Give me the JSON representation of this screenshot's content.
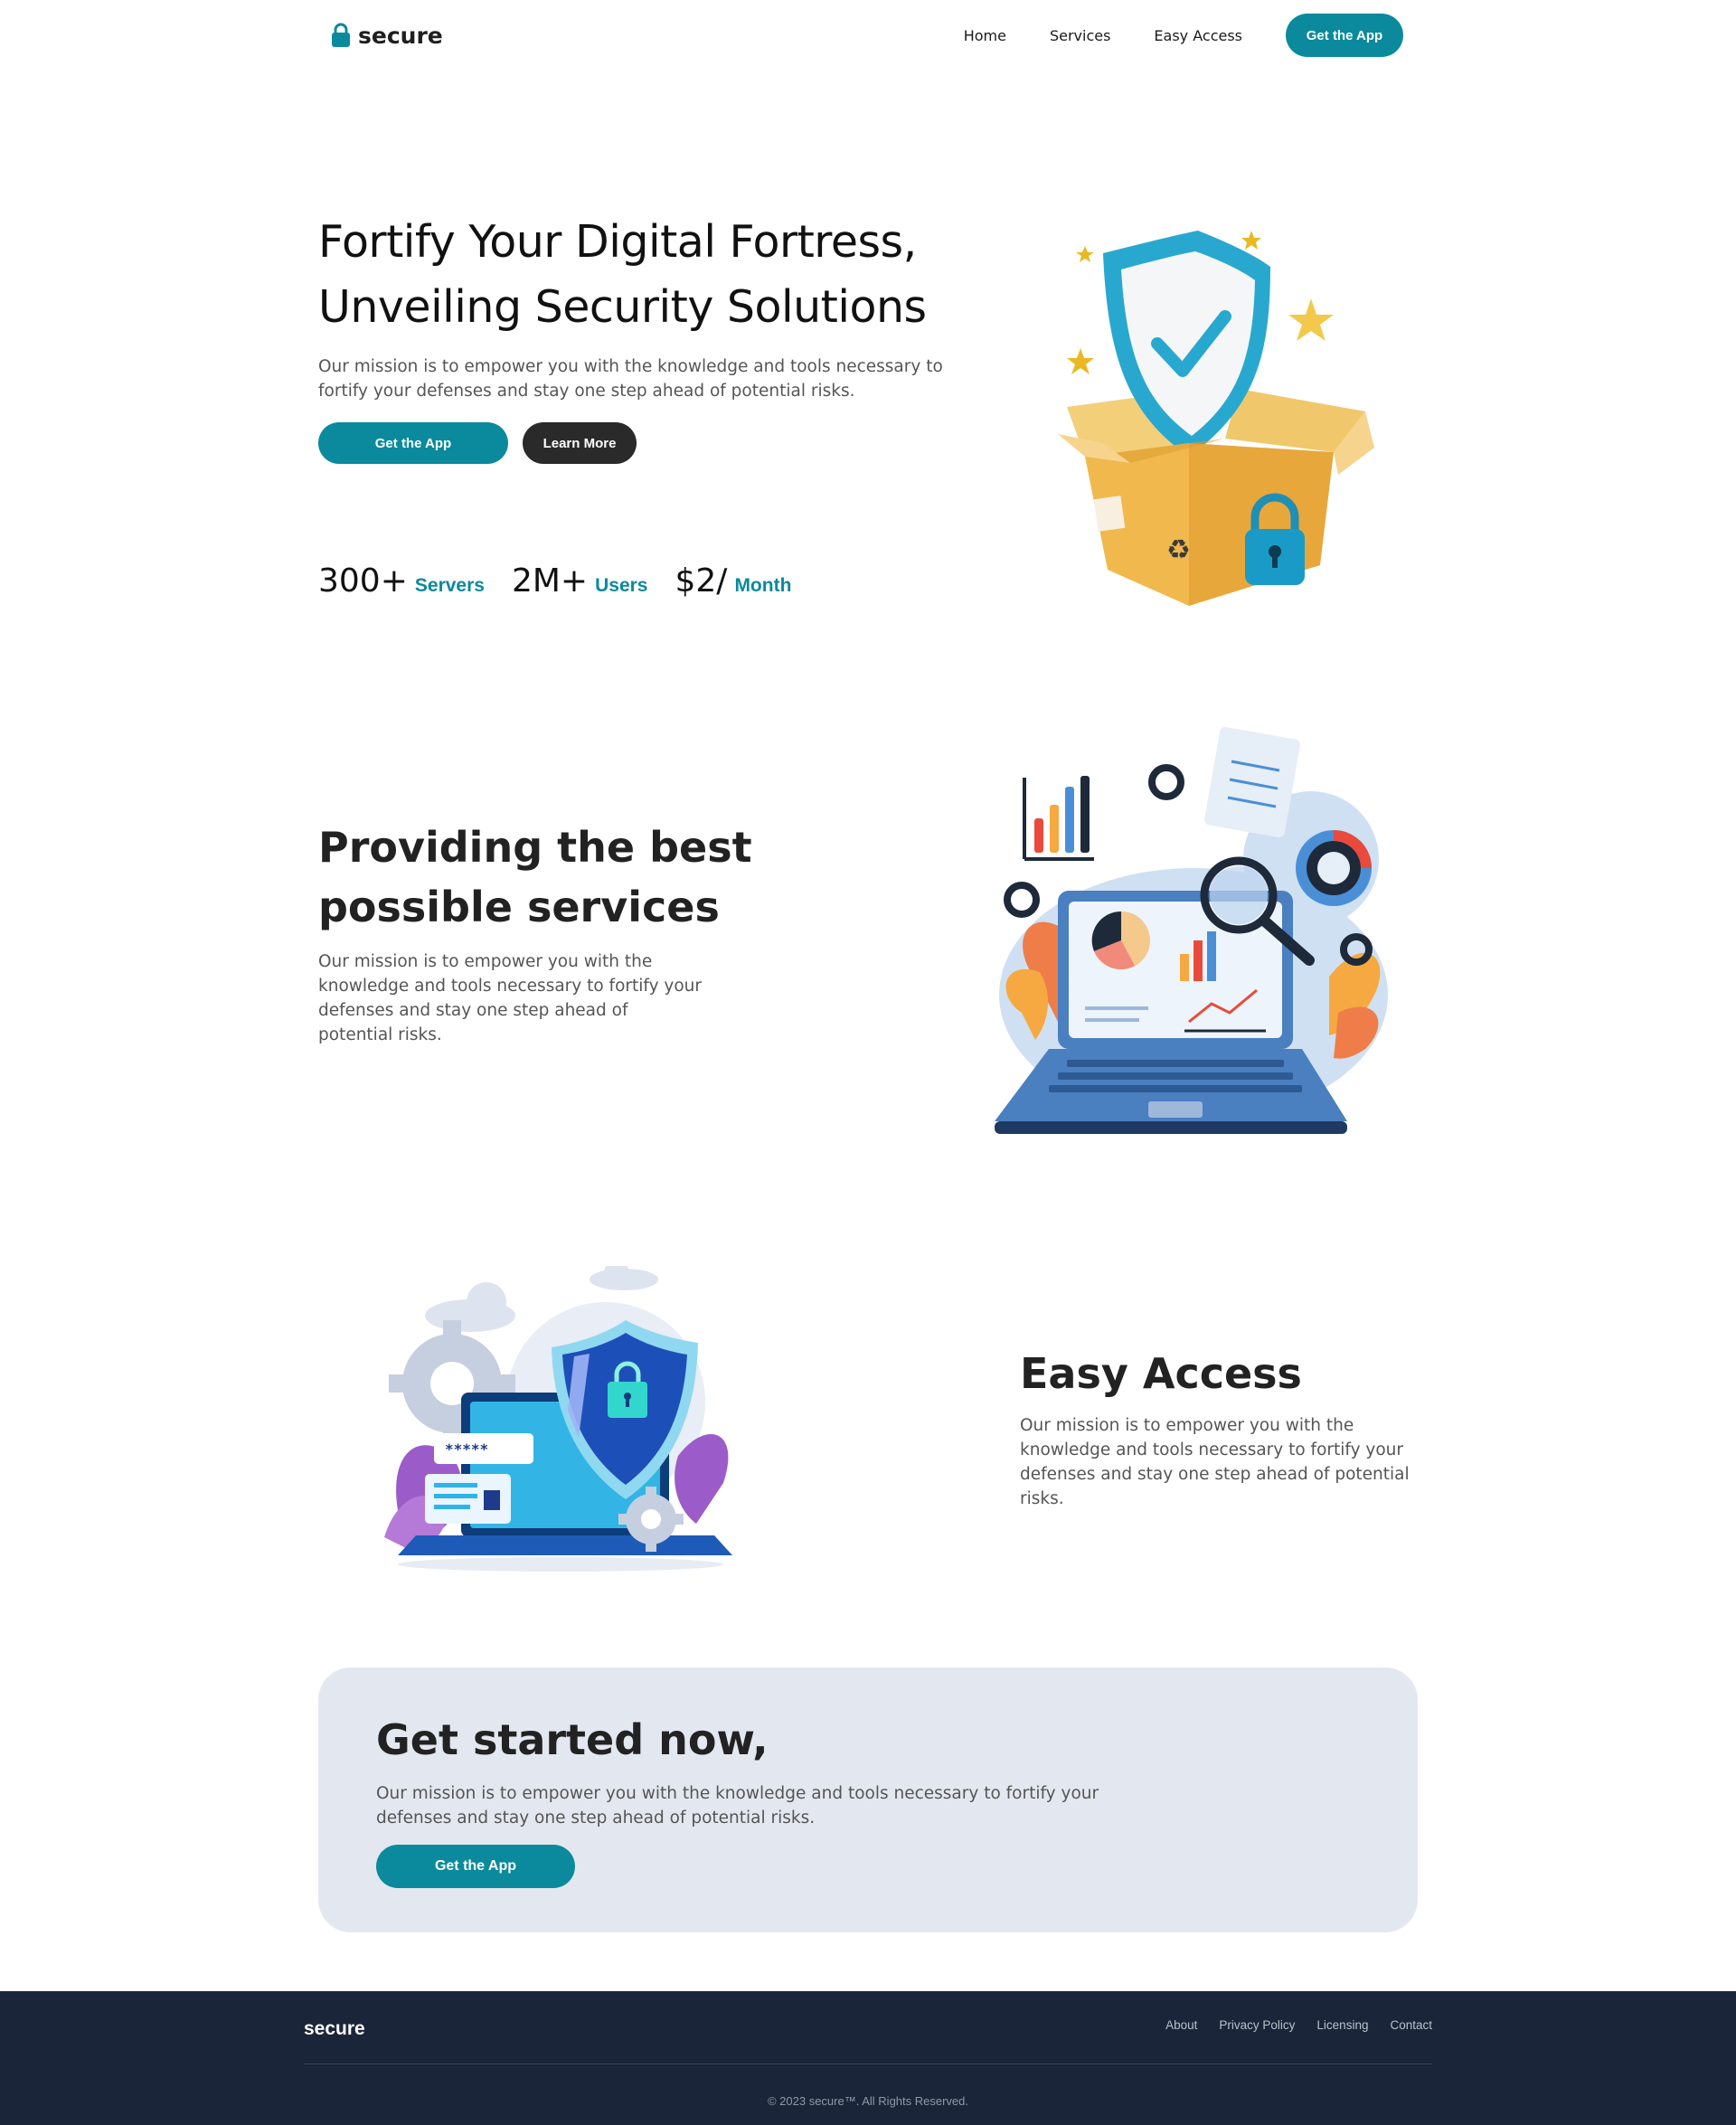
{
  "brand": {
    "name": "secure",
    "accent": "#0a8a9c",
    "dark": "#2a2a2a",
    "footer_bg": "#1b2539"
  },
  "nav": {
    "links": [
      {
        "label": "Home"
      },
      {
        "label": "Services"
      },
      {
        "label": "Easy Access"
      }
    ],
    "cta_label": "Get the App"
  },
  "hero": {
    "title_line1": "Fortify Your Digital Fortress,",
    "title_line2": "Unveiling Security Solutions",
    "description": "Our mission is to empower you with the knowledge and tools necessary to fortify your defenses and stay one step ahead of potential risks.",
    "primary_button": "Get the App",
    "secondary_button": "Learn More",
    "stats": [
      {
        "value": "300+",
        "label": "Servers"
      },
      {
        "value": "2M+",
        "label": "Users"
      },
      {
        "value": "$2/",
        "label": "Month"
      }
    ],
    "illustration_icon": "shield-box-icon"
  },
  "services": {
    "title_line1": "Providing the best",
    "title_line2": "possible services",
    "description": "Our mission is to empower you with the knowledge and tools necessary to fortify your defenses and stay one step ahead of potential risks.",
    "illustration_icon": "laptop-analytics-icon"
  },
  "easy_access": {
    "title": "Easy Access",
    "description": "Our mission is to empower you with the knowledge and tools necessary to fortify your defenses and stay one step ahead of potential risks.",
    "illustration_icon": "laptop-shield-icon"
  },
  "cta": {
    "title": "Get started now,",
    "description": "Our mission is to empower you with the knowledge and tools necessary to fortify your defenses and stay one step ahead of potential risks.",
    "button": "Get the App"
  },
  "footer": {
    "brand": "secure",
    "links": [
      {
        "label": "About"
      },
      {
        "label": "Privacy Policy"
      },
      {
        "label": "Licensing"
      },
      {
        "label": "Contact"
      }
    ],
    "copyright": "© 2023 secure™. All Rights Reserved."
  }
}
